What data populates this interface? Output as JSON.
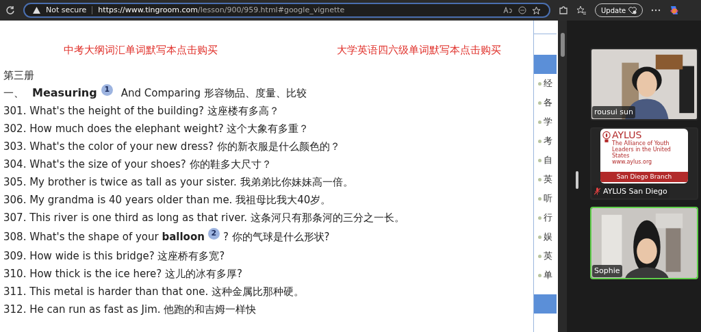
{
  "browser": {
    "security_label": "Not secure",
    "url_host": "https://www.tingroom.com",
    "url_path": "/lesson/900/959.html#google_vignette",
    "update_button": "Update"
  },
  "page": {
    "promo_links": [
      "中考大纲词汇单词默写本点击购买",
      "大学英语四六级单词默写本点击购买"
    ],
    "book_title": "第三册",
    "section_heading": {
      "number": "一、",
      "bold": "Measuring",
      "badge": "1",
      "rest": "And Comparing 形容物品、度量、比较"
    },
    "sentences": [
      {
        "text": "301. What's the height of the building? 这座楼有多高？"
      },
      {
        "text": "302. How much does the elephant weight? 这个大象有多重？"
      },
      {
        "text": "303. What's the color of your new dress? 你的新衣服是什么颜色的？"
      },
      {
        "text": "304. What's the size of your shoes? 你的鞋多大尺寸？"
      },
      {
        "text": "305. My brother is twice as tall as your sister. 我弟弟比你妹妹高一倍。"
      },
      {
        "text": "306. My grandma is 40 years older than me. 我祖母比我大40岁。"
      },
      {
        "text": "307. This river is one third as long as that river. 这条河只有那条河的三分之一长。"
      },
      {
        "text": "308. What's the shape of your **balloon**",
        "badge": "2",
        "tail": "? 你的气球是什么形状?"
      },
      {
        "text": "309. How wide is this bridge? 这座桥有多宽?"
      },
      {
        "text": "310. How thick is the ice here? 这儿的冰有多厚?"
      },
      {
        "text": "311. This metal is harder than that one. 这种金属比那种硬。"
      },
      {
        "text": "312. He can run as fast as Jim. 他跑的和吉姆一样快"
      }
    ],
    "sidebar_items": [
      "经",
      "各",
      "学",
      "考",
      "自",
      "英",
      "听",
      "行",
      "娱",
      "英",
      "单"
    ]
  },
  "participants": [
    {
      "kind": "video",
      "name": "rousui sun",
      "active_speaker": false
    },
    {
      "kind": "logo",
      "logo_title": "AYLUS",
      "logo_tagline": "The Alliance of Youth Leaders in the United States",
      "logo_site": "www.aylus.org",
      "branch": "San Diego Branch",
      "name": "AYLUS San Diego",
      "muted": true,
      "active_speaker": false
    },
    {
      "kind": "video",
      "name": "Sophie",
      "active_speaker": true
    }
  ]
}
